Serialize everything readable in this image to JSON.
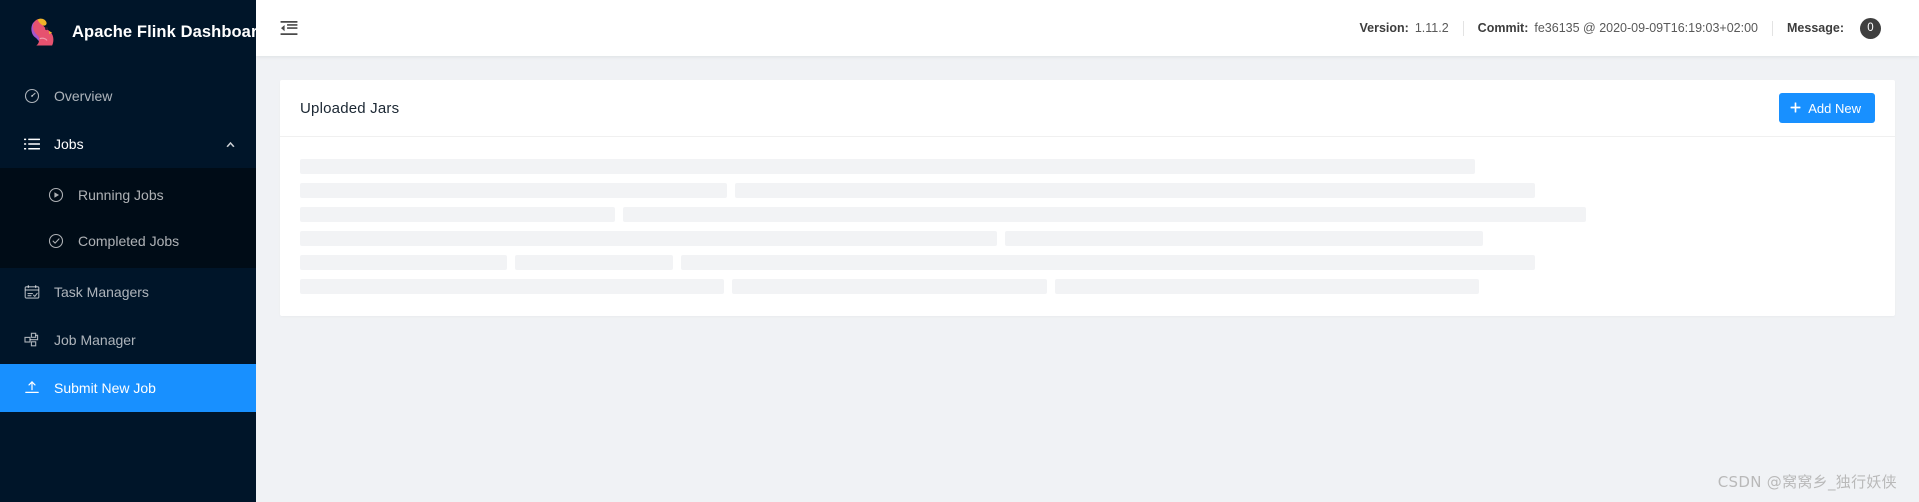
{
  "brand": {
    "title": "Apache Flink Dashboard",
    "logo_icon": "flink-squirrel-logo"
  },
  "sidebar": {
    "items": [
      {
        "label": "Overview",
        "icon": "dashboard-icon",
        "state": "normal"
      },
      {
        "label": "Jobs",
        "icon": "unordered-list-icon",
        "state": "open",
        "arrow_icon": "chevron-up-icon"
      },
      {
        "label": "Running Jobs",
        "icon": "play-circle-icon",
        "state": "sub"
      },
      {
        "label": "Completed Jobs",
        "icon": "check-circle-icon",
        "state": "sub"
      },
      {
        "label": "Task Managers",
        "icon": "schedule-icon",
        "state": "normal"
      },
      {
        "label": "Job Manager",
        "icon": "cluster-icon",
        "state": "normal"
      },
      {
        "label": "Submit New Job",
        "icon": "upload-icon",
        "state": "active"
      }
    ]
  },
  "topbar": {
    "menu_fold_icon": "menu-fold-icon",
    "version_label": "Version:",
    "version_value": "1.11.2",
    "commit_label": "Commit:",
    "commit_value": "fe36135 @ 2020-09-09T16:19:03+02:00",
    "message_label": "Message:",
    "message_count": "0"
  },
  "card": {
    "title": "Uploaded Jars",
    "add_new_label": "Add New",
    "add_new_icon": "plus-icon"
  },
  "skeleton": {
    "rows": [
      [
        1175
      ],
      [
        427,
        800
      ],
      [
        315,
        963
      ],
      [
        697,
        478
      ],
      [
        207,
        158,
        854
      ],
      [
        424,
        315,
        424
      ]
    ]
  },
  "watermark": "CSDN @窝窝乡_独行妖侠",
  "colors": {
    "sidebar_bg": "#001529",
    "submenu_bg": "#000c17",
    "accent": "#1890ff",
    "content_bg": "#f0f2f5",
    "card_bg": "#ffffff",
    "skeleton_bar": "#f2f3f5",
    "badge_bg": "#3f3f3f"
  }
}
